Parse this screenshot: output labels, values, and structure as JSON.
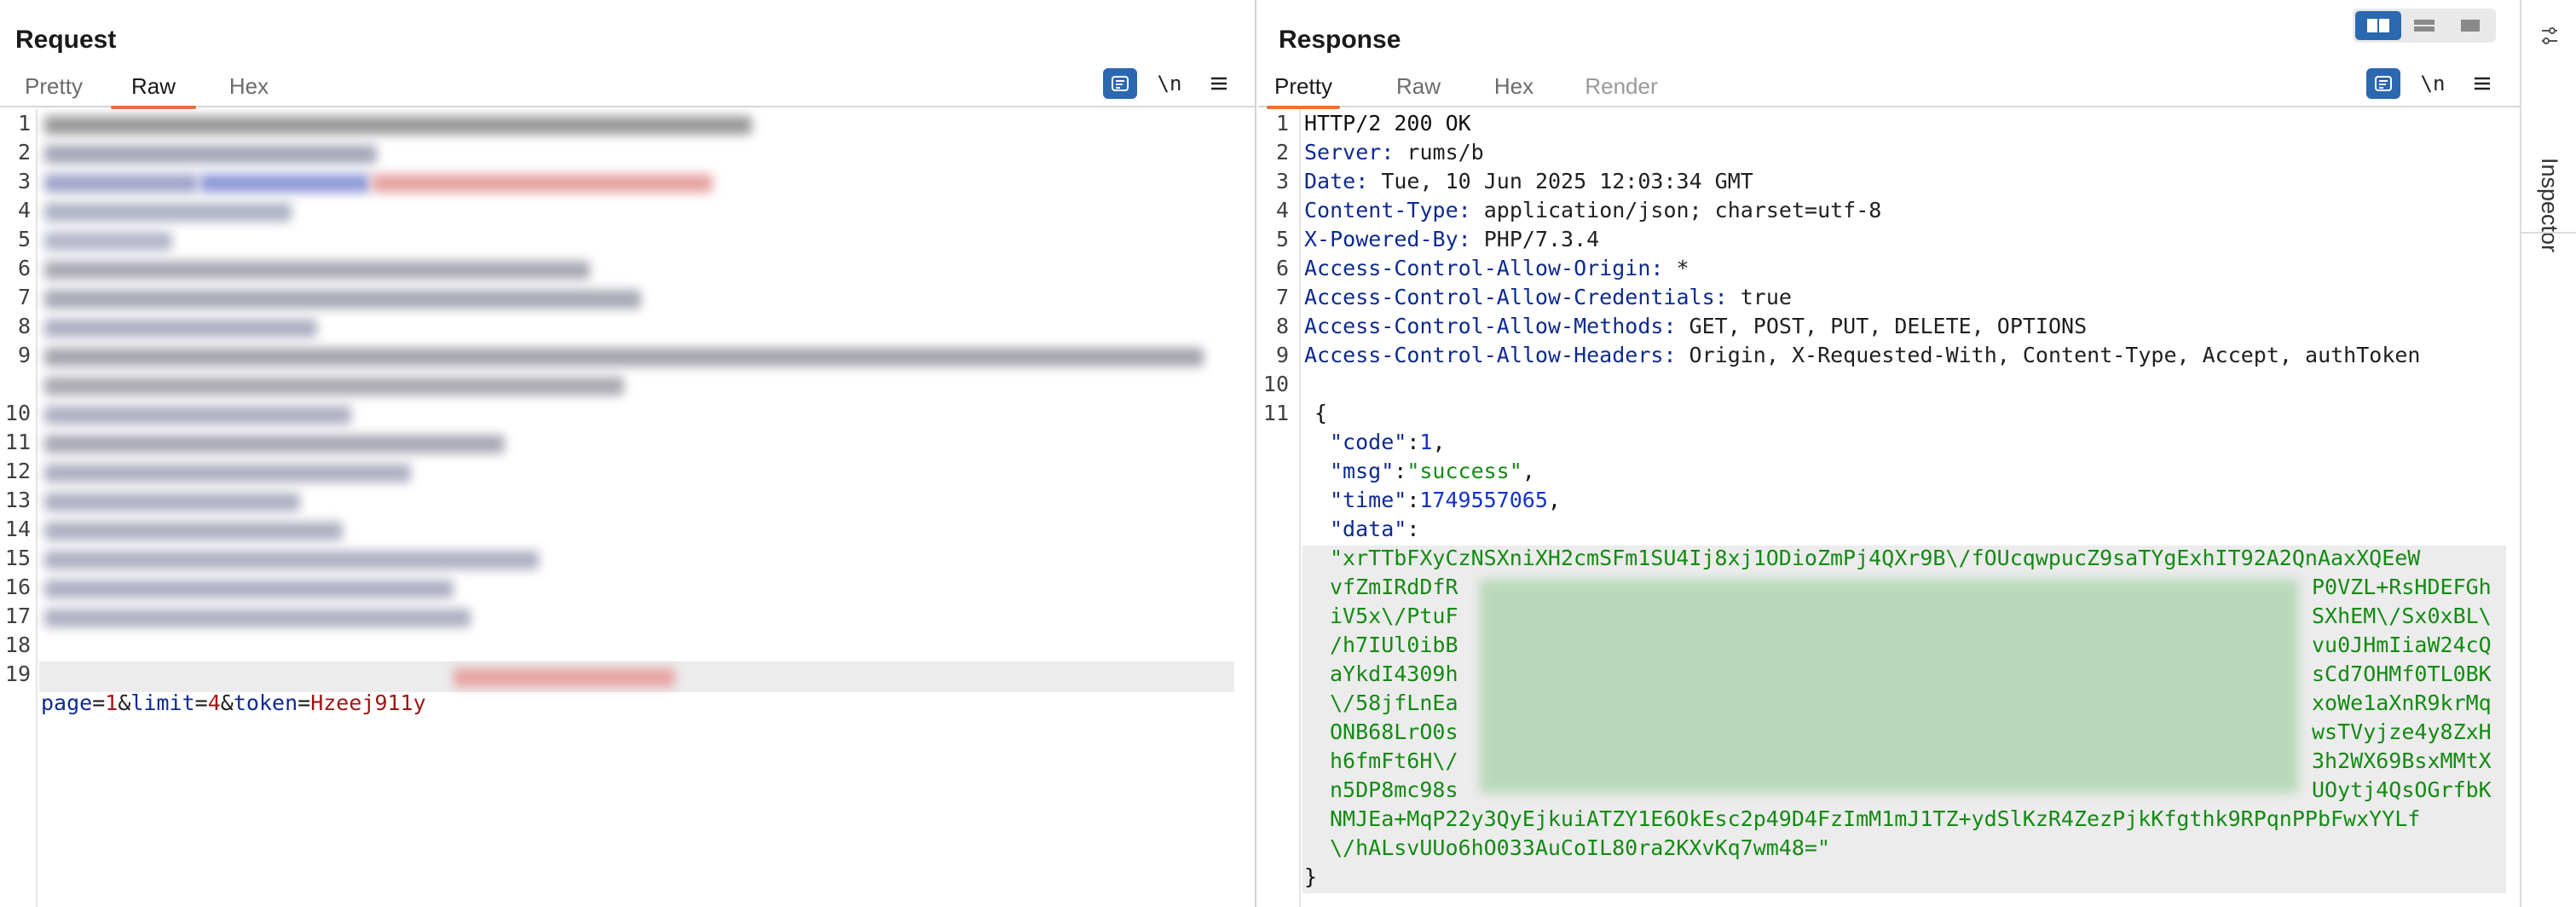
{
  "request": {
    "title": "Request",
    "tabs": [
      {
        "label": "Pretty"
      },
      {
        "label": "Raw"
      },
      {
        "label": "Hex"
      }
    ],
    "wrap_icon": "wrap-lines-icon",
    "newline_label": "\\n",
    "menu_icon": "hamburger-menu-icon",
    "line_numbers": [
      "1",
      "2",
      "3",
      "4",
      "5",
      "6",
      "7",
      "8",
      "9",
      "",
      "10",
      "11",
      "12",
      "13",
      "14",
      "15",
      "16",
      "17",
      "18",
      "19"
    ],
    "last_line": {
      "k1": "page",
      "eq1": "=",
      "v1": "1",
      "amp1": "&",
      "k2": "limit",
      "eq2": "=",
      "v2": "4",
      "amp2": "&",
      "k3": "token",
      "eq3": "=",
      "v3": "Hzeej911y"
    }
  },
  "response": {
    "title": "Response",
    "tabs": [
      {
        "label": "Pretty"
      },
      {
        "label": "Raw"
      },
      {
        "label": "Hex"
      },
      {
        "label": "Render"
      }
    ],
    "newline_label": "\\n",
    "headers": [
      {
        "n": "1",
        "text": "HTTP/2 200 OK"
      },
      {
        "n": "2",
        "k": "Server",
        "v": " rums/b"
      },
      {
        "n": "3",
        "k": "Date",
        "v": " Tue, 10 Jun 2025 12:03:34 GMT"
      },
      {
        "n": "4",
        "k": "Content-Type",
        "v": " application/json; charset=utf-8"
      },
      {
        "n": "5",
        "k": "X-Powered-By",
        "v": " PHP/7.3.4"
      },
      {
        "n": "6",
        "k": "Access-Control-Allow-Origin",
        "v": " *"
      },
      {
        "n": "7",
        "k": "Access-Control-Allow-Credentials",
        "v": " true"
      },
      {
        "n": "8",
        "k": "Access-Control-Allow-Methods",
        "v": " GET, POST, PUT, DELETE, OPTIONS"
      },
      {
        "n": "9",
        "k": "Access-Control-Allow-Headers",
        "v": " Origin, X-Requested-With, Content-Type, Accept, authToken"
      },
      {
        "n": "10"
      },
      {
        "n": "11"
      }
    ],
    "sep": ":",
    "json": {
      "open": "{",
      "code_key": "\"code\"",
      "code_val": "1",
      "msg_key": "\"msg\"",
      "msg_val": "\"success\"",
      "time_key": "\"time\"",
      "time_val": "1749557065",
      "data_key": "\"data\"",
      "data_lines": [
        "\"xrTTbFXyCzNSXniXH2cmSFm1SU4Ij8xj1ODioZmPj4QXr9B\\/fOUcqwpucZ9saTYgExhIT92A2QnAaxXQEeW",
        {
          "l": "vfZmIRdDfR",
          "r": "P0VZL+RsHDEFGh"
        },
        {
          "l": "iV5x\\/PtuF",
          "r": "SXhEM\\/Sx0xBL\\"
        },
        {
          "l": "/h7IUl0ibB",
          "r": "vu0JHmIiaW24cQ"
        },
        {
          "l": "aYkdI4309h",
          "r": "sCd7OHMf0TL0BK"
        },
        {
          "l": "\\/58jfLnEa",
          "r": "xoWe1aXnR9krMq"
        },
        {
          "l": "ONB68LrO0s",
          "r": "wsTVyjze4y8ZxH"
        },
        {
          "l": "h6fmFt6H\\/",
          "r": "3h2WX69BsxMMtX"
        },
        {
          "l": "n5DP8mc98s",
          "r": "UOytj4QsOGrfbK"
        },
        "NMJEa+MqP22y3QyEjkuiATZY1E6OkEsc2p49D4FzImM1mJ1TZ+ydSlKzR4ZezPjkKfgthk9RPqnPPbFwxYYLf",
        "\\/hALsvUUo6hO033AuCoIL80ra2KXvKq7wm48=\""
      ],
      "close": "}"
    }
  },
  "inspector": {
    "label": "Inspector"
  },
  "layout_toggle": [
    "split-horizontal-icon",
    "split-vertical-icon",
    "single-pane-icon"
  ],
  "colors": {
    "accent": "#e8703a",
    "button_blue": "#2b68b0",
    "header_key": "#0d2a8f",
    "json_string": "#148a14",
    "json_number": "#1432c8",
    "param_value": "#a11515"
  }
}
